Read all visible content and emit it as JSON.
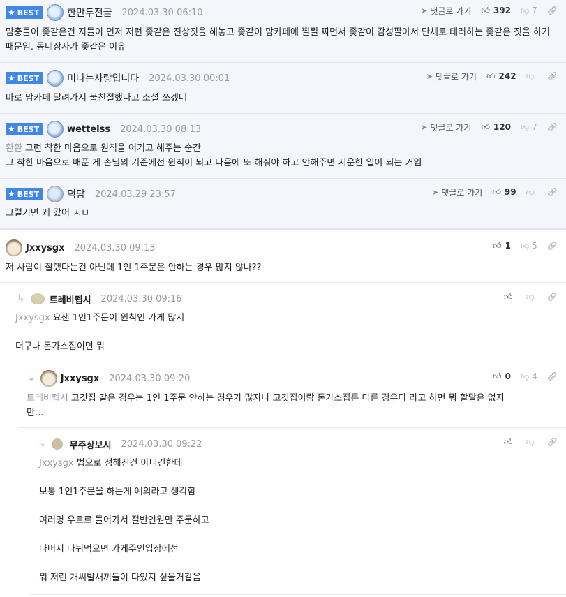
{
  "best_badge": "BEST",
  "reply_link_label": "댓글로 가기",
  "best_comments": [
    {
      "nick": "한만두전골",
      "date": "2024.03.30 06:10",
      "likes": "392",
      "dislikes": "7",
      "text": "맘충들이 좆같은건 지들이 먼저 저런 좆같은 진상짓을 해놓고 좆같이 맘카페에 찔찔 짜면서 좆같이 감성팔아서 단체로 테러하는 좆같은 짓을 하기 때문임. 동네장사가 좆같은 이유"
    },
    {
      "nick": "미나는사랑입니다",
      "date": "2024.03.30 00:01",
      "likes": "242",
      "dislikes": "",
      "text": "바로 맘카페 달려가서 불친절했다고 소설 쓰겠네"
    },
    {
      "nick": "wettelss",
      "date": "2024.03.30 08:13",
      "likes": "120",
      "dislikes": "7",
      "mention": "환환",
      "text1": "그런 착한 마음으로 원칙을 어기고 해주는 순간",
      "text2": "그 착한 마음으로 배푼 게 손님의 기준에선 원칙이 되고 다음에 또 해줘야 하고 안해주면 서운한 일이 되는 거임"
    },
    {
      "nick": "덕담",
      "date": "2024.03.29 23:57",
      "likes": "99",
      "dislikes": "",
      "text": "그럴거면 왜 갔어 ㅅㅂ"
    }
  ],
  "comments": [
    {
      "nick": "Jxxysgx",
      "date": "2024.03.30 09:13",
      "likes": "1",
      "dislikes": "5",
      "text": "저 사람이 잘했다는건 아닌데 1인 1주문은 안하는 경우 많지 않나??"
    },
    {
      "nick": "트레비펩시",
      "date": "2024.03.30 09:16",
      "mention": "Jxxysgx",
      "text1": "요샌 1인1주문이 원칙인 가게 많지",
      "text2": "더구나 돈가스집이면 뭐"
    },
    {
      "nick": "Jxxysgx",
      "date": "2024.03.30 09:20",
      "likes": "0",
      "dislikes": "4",
      "mention": "트레비펩시",
      "text1": "고깃집 같은 경우는 1인 1주문 안하는 경우가 많자나 고깃집이랑 돈가스집른 다른 경우다 라고 하면 뭐 할말은 없지",
      "text2": "만..."
    },
    {
      "nick": "무주상보시",
      "date": "2024.03.30 09:22",
      "mention": "Jxxysgx",
      "lines": [
        "법으로 정해진건 아니긴한데",
        "보통 1인1주문을 하는게 예의라고 생각함",
        "여러명 우르르 들어가서 절반인원만 주문하고",
        "나머지 나눠먹으면 가게주인입장에선",
        "뭐 저런 개씨발새끼들이 다있지 싶을거같음"
      ]
    }
  ]
}
